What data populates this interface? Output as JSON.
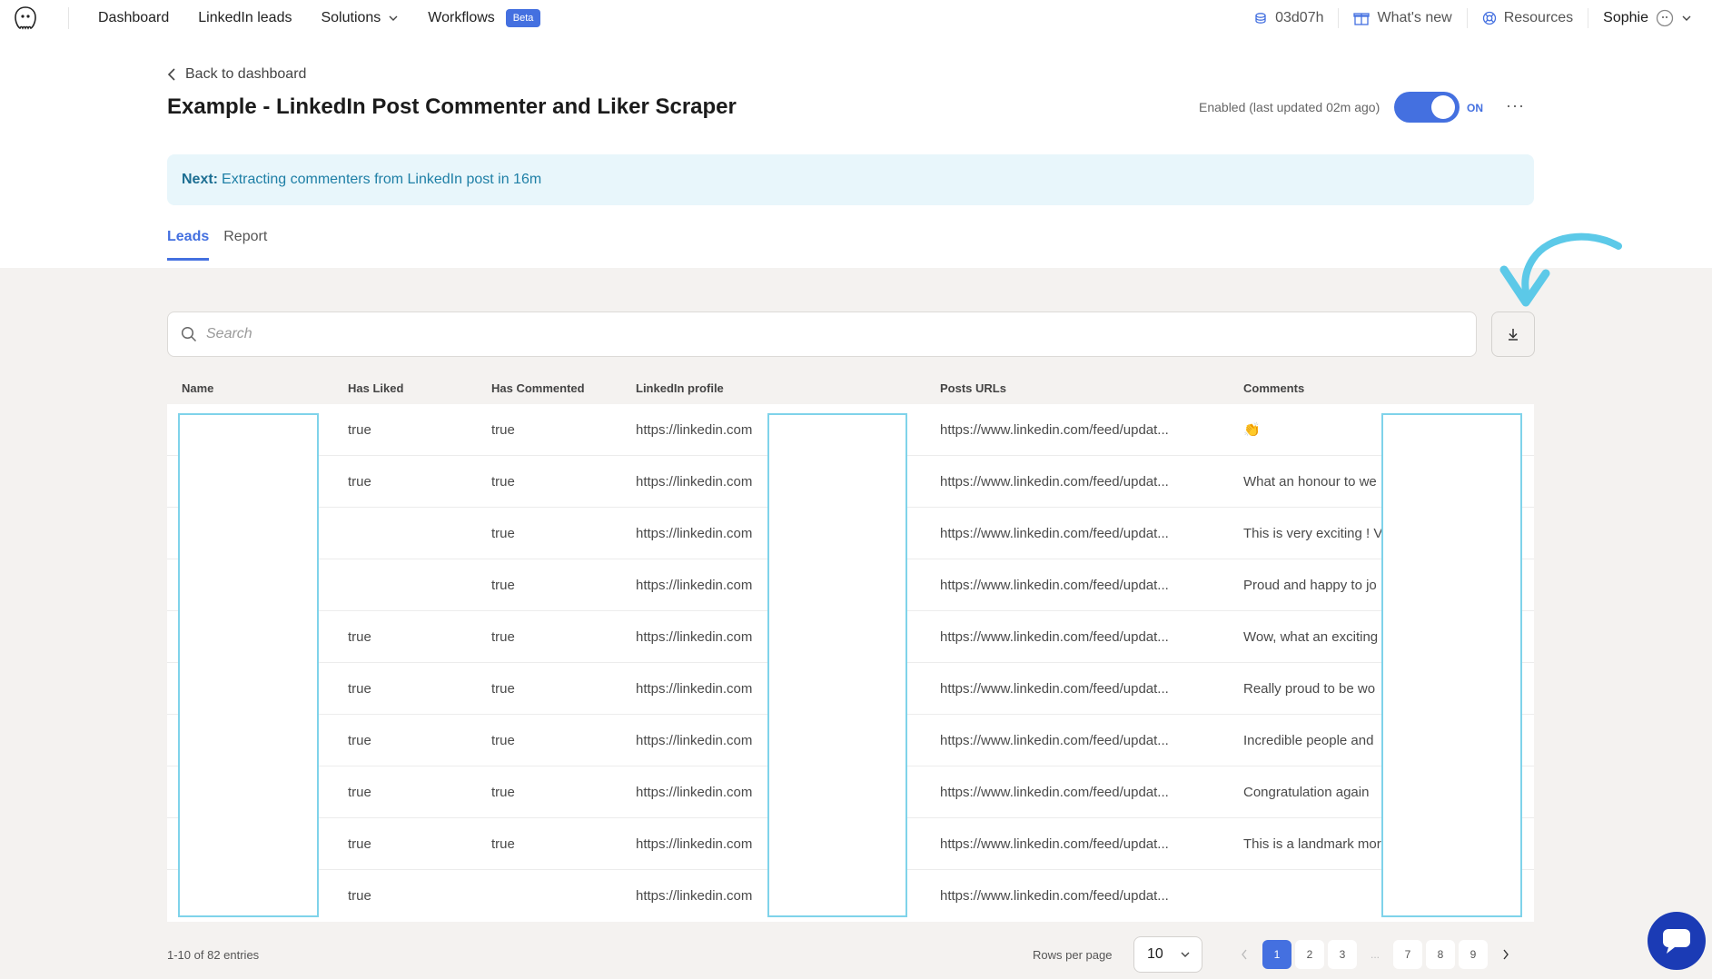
{
  "nav": {
    "links": [
      {
        "label": "Dashboard"
      },
      {
        "label": "LinkedIn leads"
      },
      {
        "label": "Solutions"
      },
      {
        "label": "Workflows",
        "badge": "Beta"
      }
    ],
    "credits": "03d07h",
    "whats_new": "What's new",
    "resources": "Resources",
    "user": "Sophie"
  },
  "header": {
    "back_label": "Back to dashboard",
    "title": "Example - LinkedIn Post Commenter and Liker Scraper",
    "status_text": "Enabled (last updated 02m ago)",
    "toggle_label": "ON",
    "more_label": "···"
  },
  "banner": {
    "prefix": "Next:",
    "text": "Extracting commenters from LinkedIn post in 16m"
  },
  "tabs": [
    {
      "label": "Leads",
      "active": true
    },
    {
      "label": "Report",
      "active": false
    }
  ],
  "search": {
    "placeholder": "Search"
  },
  "table": {
    "columns": [
      "Name",
      "Has Liked",
      "Has Commented",
      "LinkedIn profile",
      "Posts URLs",
      "Comments"
    ],
    "rows": [
      {
        "liked": "true",
        "commented": "true",
        "profile": "https://linkedin.com",
        "post": "https://www.linkedin.com/feed/updat...",
        "comment": "👏"
      },
      {
        "liked": "true",
        "commented": "true",
        "profile": "https://linkedin.com",
        "post": "https://www.linkedin.com/feed/updat...",
        "comment": "What an honour to we"
      },
      {
        "liked": "",
        "commented": "true",
        "profile": "https://linkedin.com",
        "post": "https://www.linkedin.com/feed/updat...",
        "comment": "This is very exciting ! V"
      },
      {
        "liked": "",
        "commented": "true",
        "profile": "https://linkedin.com",
        "post": "https://www.linkedin.com/feed/updat...",
        "comment": "Proud and happy to jo"
      },
      {
        "liked": "true",
        "commented": "true",
        "profile": "https://linkedin.com",
        "post": "https://www.linkedin.com/feed/updat...",
        "comment": "Wow, what an exciting"
      },
      {
        "liked": "true",
        "commented": "true",
        "profile": "https://linkedin.com",
        "post": "https://www.linkedin.com/feed/updat...",
        "comment": "Really proud to be wo"
      },
      {
        "liked": "true",
        "commented": "true",
        "profile": "https://linkedin.com",
        "post": "https://www.linkedin.com/feed/updat...",
        "comment": "Incredible people and"
      },
      {
        "liked": "true",
        "commented": "true",
        "profile": "https://linkedin.com",
        "post": "https://www.linkedin.com/feed/updat...",
        "comment": "Congratulation again"
      },
      {
        "liked": "true",
        "commented": "true",
        "profile": "https://linkedin.com",
        "post": "https://www.linkedin.com/feed/updat...",
        "comment": "This is a landmark mor"
      },
      {
        "liked": "true",
        "commented": "",
        "profile": "https://linkedin.com",
        "post": "https://www.linkedin.com/feed/updat...",
        "comment": ""
      }
    ]
  },
  "footer": {
    "entries": "1-10 of 82 entries",
    "rows_per_page_label": "Rows per page",
    "rows_per_page_value": "10",
    "pages": [
      "1",
      "2",
      "3",
      "...",
      "7",
      "8",
      "9"
    ],
    "active_page": "1"
  },
  "colors": {
    "accent": "#4470e0",
    "banner_bg": "#e8f6fb",
    "redaction_border": "#7fd3ea",
    "annotation_arrow": "#5cc9e8",
    "chat_button": "#1b3bb5"
  }
}
